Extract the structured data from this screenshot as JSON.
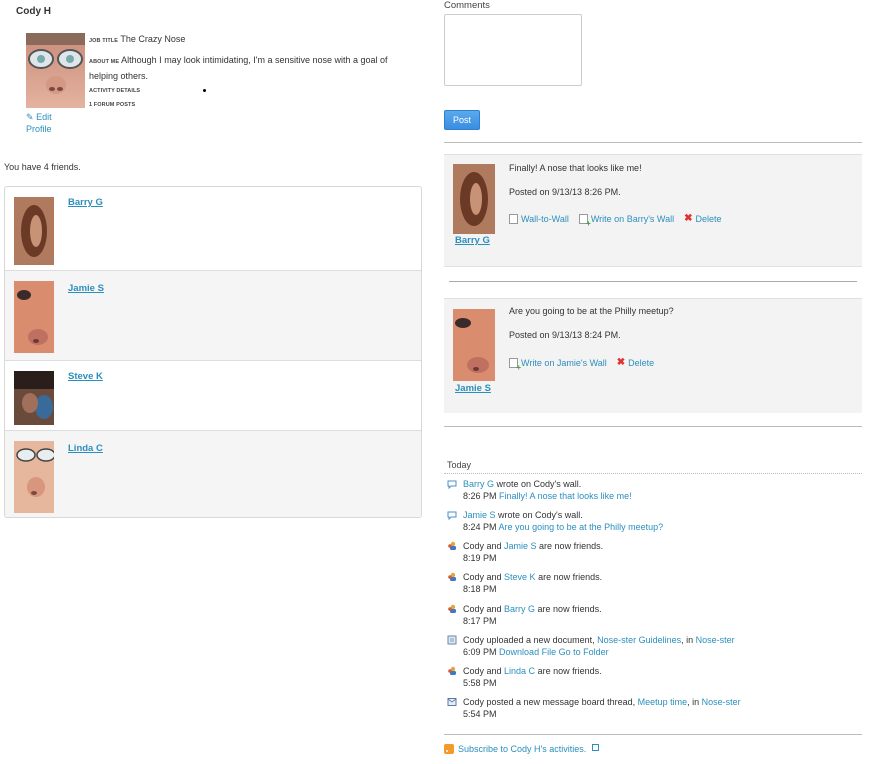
{
  "profile": {
    "name": "Cody H",
    "job_title_label": "JOB TITLE",
    "job_title": "The Crazy Nose",
    "about_label": "ABOUT ME",
    "about": "Although I may look intimidating, I'm a sensitive nose with a goal of helping others.",
    "activity_details_label": "ACTIVITY DETAILS",
    "forum_posts": "1 FORUM POSTS",
    "edit_profile": "Edit Profile"
  },
  "friends": {
    "count_text": "You have 4 friends.",
    "items": [
      {
        "name": "Barry G"
      },
      {
        "name": "Jamie S"
      },
      {
        "name": "Steve K"
      },
      {
        "name": "Linda C"
      }
    ]
  },
  "comment_form": {
    "label": "Comments",
    "value": "",
    "post_label": "Post"
  },
  "wall": {
    "posts": [
      {
        "author": "Barry G",
        "message": "Finally! A nose that looks like me!",
        "posted": "Posted on 9/13/13 8:26 PM.",
        "actions": [
          "Wall-to-Wall",
          "Write on Barry's Wall",
          "Delete"
        ]
      },
      {
        "author": "Jamie S",
        "message": "Are you going to be at the Philly meetup?",
        "posted": "Posted on 9/13/13 8:24 PM.",
        "actions": [
          "Write on Jamie's Wall",
          "Delete"
        ]
      }
    ]
  },
  "activity": {
    "day_label": "Today",
    "items": [
      {
        "icon": "comment-icon",
        "a": "Barry G",
        "b": " wrote on Cody's wall.",
        "time": "8:26 PM",
        "link": "Finally! A nose that looks like me!"
      },
      {
        "icon": "comment-icon",
        "a": "Jamie S",
        "b": " wrote on Cody's wall.",
        "time": "8:24 PM",
        "link": "Are you going to be at the Philly meetup?"
      },
      {
        "icon": "friends-icon",
        "pre": "Cody and ",
        "a": "Jamie S",
        "b": " are now friends.",
        "time": "8:19 PM"
      },
      {
        "icon": "friends-icon",
        "pre": "Cody and ",
        "a": "Steve K",
        "b": " are now friends.",
        "time": "8:18 PM"
      },
      {
        "icon": "friends-icon",
        "pre": "Cody and ",
        "a": "Barry G",
        "b": " are now friends.",
        "time": "8:17 PM"
      },
      {
        "icon": "document-icon",
        "pre": "Cody uploaded a new document, ",
        "a": "Nose-ster Guidelines",
        "mid": ", in ",
        "c": "Nose-ster",
        "time": "6:09 PM",
        "link": "Download File",
        "link2": "Go to Folder"
      },
      {
        "icon": "friends-icon",
        "pre": "Cody and ",
        "a": "Linda C",
        "b": " are now friends.",
        "time": "5:58 PM"
      },
      {
        "icon": "message-board-icon",
        "pre": "Cody posted a new message board thread, ",
        "a": "Meetup time",
        "mid": ", in ",
        "c": "Nose-ster",
        "time": "5:54 PM"
      }
    ],
    "subscribe": "Subscribe to Cody H's activities."
  },
  "colors": {
    "link": "#2a8fbd",
    "post_button": "#3a8ee0",
    "wall_bg": "#f3f3f3",
    "delete": "#e03030",
    "rss": "#f39a2b"
  }
}
